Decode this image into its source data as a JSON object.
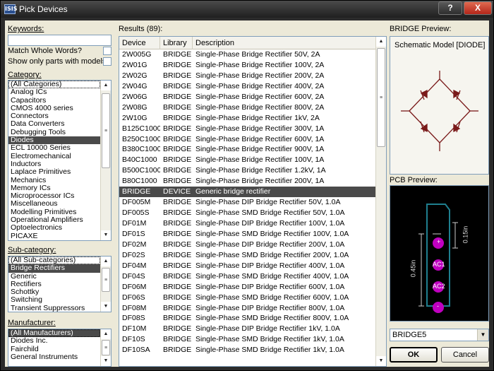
{
  "window": {
    "title": "Pick Devices",
    "icon_text": "ISIS",
    "help_label": "?",
    "close_label": "X"
  },
  "keywords": {
    "label": "Keywords:",
    "value": ""
  },
  "options": {
    "match_whole_words": "Match Whole Words?",
    "only_models": "Show only parts with models?"
  },
  "category": {
    "label": "Category:",
    "items": [
      "(All Categories)",
      "Analog ICs",
      "Capacitors",
      "CMOS 4000 series",
      "Connectors",
      "Data Converters",
      "Debugging Tools",
      "Diodes",
      "ECL 10000 Series",
      "Electromechanical",
      "Inductors",
      "Laplace Primitives",
      "Mechanics",
      "Memory ICs",
      "Microprocessor ICs",
      "Miscellaneous",
      "Modelling Primitives",
      "Operational Amplifiers",
      "Optoelectronics",
      "PICAXE"
    ],
    "selected_index": 7
  },
  "subcategory": {
    "label": "Sub-category:",
    "items": [
      "(All Sub-categories)",
      "Bridge Rectifiers",
      "Generic",
      "Rectifiers",
      "Schottky",
      "Switching",
      "Transient Suppressors"
    ],
    "selected_index": 1
  },
  "manufacturer": {
    "label": "Manufacturer:",
    "items": [
      "(All Manufacturers)",
      "Diodes Inc.",
      "Fairchild",
      "General Instruments"
    ],
    "selected_index": 0
  },
  "results": {
    "label": "Results (89):",
    "columns": [
      "Device",
      "Library",
      "Description"
    ],
    "selected_index": 14,
    "rows": [
      [
        "2W005G",
        "BRIDGE",
        "Single-Phase Bridge Rectifier 50V, 2A"
      ],
      [
        "2W01G",
        "BRIDGE",
        "Single-Phase Bridge Rectifier 100V, 2A"
      ],
      [
        "2W02G",
        "BRIDGE",
        "Single-Phase Bridge Rectifier 200V, 2A"
      ],
      [
        "2W04G",
        "BRIDGE",
        "Single-Phase Bridge Rectifier 400V, 2A"
      ],
      [
        "2W06G",
        "BRIDGE",
        "Single-Phase Bridge Rectifier 600V, 2A"
      ],
      [
        "2W08G",
        "BRIDGE",
        "Single-Phase Bridge Rectifier 800V, 2A"
      ],
      [
        "2W10G",
        "BRIDGE",
        "Single-Phase Bridge Rectifier 1kV, 2A"
      ],
      [
        "B125C1000",
        "BRIDGE",
        "Single-Phase Bridge Rectifier 300V, 1A"
      ],
      [
        "B250C1000",
        "BRIDGE",
        "Single-Phase Bridge Rectifier 600V, 1A"
      ],
      [
        "B380C1000",
        "BRIDGE",
        "Single-Phase Bridge Rectifier 900V, 1A"
      ],
      [
        "B40C1000",
        "BRIDGE",
        "Single-Phase Bridge Rectifier 100V, 1A"
      ],
      [
        "B500C1000",
        "BRIDGE",
        "Single-Phase Bridge Rectifier 1.2kV, 1A"
      ],
      [
        "B80C1000",
        "BRIDGE",
        "Single-Phase Bridge Rectifier 200V, 1A"
      ],
      [
        "BRIDGE",
        "DEVICE",
        "Generic bridge rectifier"
      ],
      [
        "DF005M",
        "BRIDGE",
        "Single-Phase DIP Bridge Rectifier 50V, 1.0A"
      ],
      [
        "DF005S",
        "BRIDGE",
        "Single-Phase SMD Bridge Rectifier 50V, 1.0A"
      ],
      [
        "DF01M",
        "BRIDGE",
        "Single-Phase DIP Bridge Rectifier 100V, 1.0A"
      ],
      [
        "DF01S",
        "BRIDGE",
        "Single-Phase SMD Bridge Rectifier 100V, 1.0A"
      ],
      [
        "DF02M",
        "BRIDGE",
        "Single-Phase DIP Bridge Rectifier 200V, 1.0A"
      ],
      [
        "DF02S",
        "BRIDGE",
        "Single-Phase SMD Bridge Rectifier 200V, 1.0A"
      ],
      [
        "DF04M",
        "BRIDGE",
        "Single-Phase DIP Bridge Rectifier 400V, 1.0A"
      ],
      [
        "DF04S",
        "BRIDGE",
        "Single-Phase SMD Bridge Rectifier 400V, 1.0A"
      ],
      [
        "DF06M",
        "BRIDGE",
        "Single-Phase DIP Bridge Rectifier 600V, 1.0A"
      ],
      [
        "DF06S",
        "BRIDGE",
        "Single-Phase SMD Bridge Rectifier 600V, 1.0A"
      ],
      [
        "DF08M",
        "BRIDGE",
        "Single-Phase DIP Bridge Rectifier 800V, 1.0A"
      ],
      [
        "DF08S",
        "BRIDGE",
        "Single-Phase SMD Bridge Rectifier 800V, 1.0A"
      ],
      [
        "DF10M",
        "BRIDGE",
        "Single-Phase DIP Bridge Rectifier 1kV, 1.0A"
      ],
      [
        "DF10S",
        "BRIDGE",
        "Single-Phase SMD Bridge Rectifier 1kV, 1.0A"
      ],
      [
        "DF10SA",
        "BRIDGE",
        "Single-Phase SMD Bridge Rectifier 1kV, 1.0A"
      ]
    ]
  },
  "schematic_preview": {
    "label": "BRIDGE Preview:",
    "model": "Schematic Model [DIODE]",
    "line_color": "#7a1a1a"
  },
  "pcb_preview": {
    "label": "PCB Preview:",
    "pads": [
      "+",
      "AC1",
      "AC2",
      "-"
    ],
    "dim_vertical": "0.45in",
    "dim_pitch": "0.15in",
    "package_options": [
      "BRIDGE5"
    ],
    "package": "BRIDGE5",
    "pad_color": "#c000c0",
    "body_color": "#1f7f8f"
  },
  "buttons": {
    "ok": "OK",
    "cancel": "Cancel"
  }
}
